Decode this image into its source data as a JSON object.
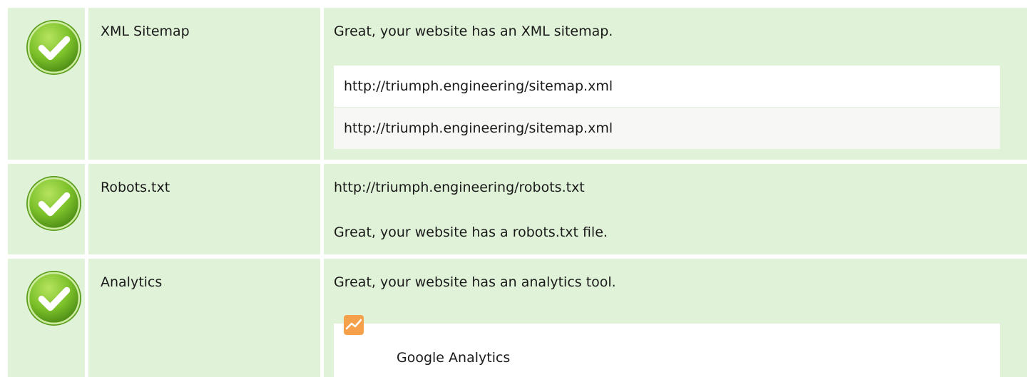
{
  "rows": [
    {
      "status": "pass",
      "label": "XML Sitemap",
      "message": "Great, your website has an XML sitemap.",
      "urls": [
        "http://triumph.engineering/sitemap.xml",
        "http://triumph.engineering/sitemap.xml"
      ]
    },
    {
      "status": "pass",
      "label": "Robots.txt",
      "url": "http://triumph.engineering/robots.txt",
      "message": "Great, your website has a robots.txt file."
    },
    {
      "status": "pass",
      "label": "Analytics",
      "message": "Great, your website has an analytics tool.",
      "tools": [
        {
          "name": "Google Analytics",
          "icon": "google-analytics-icon"
        }
      ]
    }
  ],
  "colors": {
    "row_background": "#e0f2d8",
    "check_green": "#7cc12a",
    "ga_orange": "#f5a04a"
  }
}
